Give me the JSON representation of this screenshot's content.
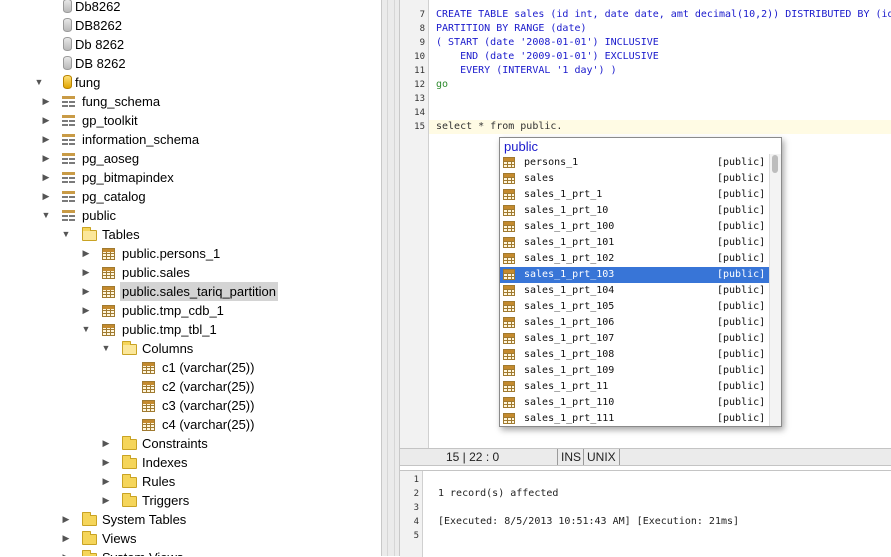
{
  "tree": {
    "items": [
      {
        "label": "Db8262",
        "icon": "database-icon",
        "arrow": "",
        "level": 0
      },
      {
        "label": "DB8262",
        "icon": "database-icon",
        "arrow": "",
        "level": 0
      },
      {
        "label": "Db 8262",
        "icon": "database-icon",
        "arrow": "",
        "level": 0
      },
      {
        "label": "DB 8262",
        "icon": "database-icon",
        "arrow": "",
        "level": 0
      },
      {
        "label": "fung",
        "icon": "database-icon-gold",
        "arrow": "▼",
        "level": 0
      },
      {
        "label": "fung_schema",
        "icon": "schema-icon",
        "arrow": "▶",
        "level": 1
      },
      {
        "label": "gp_toolkit",
        "icon": "schema-icon",
        "arrow": "▶",
        "level": 1
      },
      {
        "label": "information_schema",
        "icon": "schema-icon",
        "arrow": "▶",
        "level": 1
      },
      {
        "label": "pg_aoseg",
        "icon": "schema-icon",
        "arrow": "▶",
        "level": 1
      },
      {
        "label": "pg_bitmapindex",
        "icon": "schema-icon",
        "arrow": "▶",
        "level": 1
      },
      {
        "label": "pg_catalog",
        "icon": "schema-icon",
        "arrow": "▶",
        "level": 1
      },
      {
        "label": "public",
        "icon": "schema-icon",
        "arrow": "▼",
        "level": 1
      },
      {
        "label": "Tables",
        "icon": "folder-open-icon",
        "arrow": "▼",
        "level": 2
      },
      {
        "label": "public.persons_1",
        "icon": "table-icon",
        "arrow": "▶",
        "level": 3
      },
      {
        "label": "public.sales",
        "icon": "table-icon",
        "arrow": "▶",
        "level": 3
      },
      {
        "label": "public.sales_tariq_partition",
        "icon": "table-icon",
        "arrow": "▶",
        "level": 3,
        "selected": true
      },
      {
        "label": "public.tmp_cdb_1",
        "icon": "table-icon",
        "arrow": "▶",
        "level": 3
      },
      {
        "label": "public.tmp_tbl_1",
        "icon": "table-icon",
        "arrow": "▼",
        "level": 3
      },
      {
        "label": "Columns",
        "icon": "folder-open-icon",
        "arrow": "▼",
        "level": 4
      },
      {
        "label": "c1 (varchar(25))",
        "icon": "column-icon",
        "arrow": "",
        "level": 5
      },
      {
        "label": "c2 (varchar(25))",
        "icon": "column-icon",
        "arrow": "",
        "level": 5
      },
      {
        "label": "c3 (varchar(25))",
        "icon": "column-icon",
        "arrow": "",
        "level": 5
      },
      {
        "label": "c4 (varchar(25))",
        "icon": "column-icon",
        "arrow": "",
        "level": 5
      },
      {
        "label": "Constraints",
        "icon": "folder-icon",
        "arrow": "▶",
        "level": 4
      },
      {
        "label": "Indexes",
        "icon": "folder-icon",
        "arrow": "▶",
        "level": 4
      },
      {
        "label": "Rules",
        "icon": "folder-icon",
        "arrow": "▶",
        "level": 4
      },
      {
        "label": "Triggers",
        "icon": "folder-icon",
        "arrow": "▶",
        "level": 4
      },
      {
        "label": "System Tables",
        "icon": "folder-icon",
        "arrow": "▶",
        "level": 2
      },
      {
        "label": "Views",
        "icon": "folder-icon",
        "arrow": "▶",
        "level": 2
      },
      {
        "label": "System Views",
        "icon": "folder-icon",
        "arrow": "▶",
        "level": 2
      }
    ]
  },
  "editor": {
    "line_numbers": [
      "7",
      "8",
      "9",
      "10",
      "11",
      "12",
      "13",
      "14",
      "15"
    ],
    "lines": [
      "CREATE TABLE sales (id int, date date, amt decimal(10,2)) DISTRIBUTED BY (id)",
      "PARTITION BY RANGE (date)",
      "( START (date '2008-01-01') INCLUSIVE",
      "    END (date '2009-01-01') EXCLUSIVE",
      "    EVERY (INTERVAL '1 day') )",
      "go",
      "",
      "",
      "select * from public."
    ]
  },
  "status": {
    "position": "15 | 22 : 0",
    "mode": "INS",
    "line_ending": "UNIX"
  },
  "output": {
    "line_numbers": [
      "1",
      "2",
      "3",
      "4",
      "5"
    ],
    "lines": [
      "",
      "1 record(s) affected",
      "",
      "[Executed: 8/5/2013 10:51:43 AM] [Execution: 21ms]",
      ""
    ]
  },
  "autocomplete": {
    "title": "public",
    "selected_index": 7,
    "items": [
      {
        "name": "persons_1",
        "schema": "[public]"
      },
      {
        "name": "sales",
        "schema": "[public]"
      },
      {
        "name": "sales_1_prt_1",
        "schema": "[public]"
      },
      {
        "name": "sales_1_prt_10",
        "schema": "[public]"
      },
      {
        "name": "sales_1_prt_100",
        "schema": "[public]"
      },
      {
        "name": "sales_1_prt_101",
        "schema": "[public]"
      },
      {
        "name": "sales_1_prt_102",
        "schema": "[public]"
      },
      {
        "name": "sales_1_prt_103",
        "schema": "[public]"
      },
      {
        "name": "sales_1_prt_104",
        "schema": "[public]"
      },
      {
        "name": "sales_1_prt_105",
        "schema": "[public]"
      },
      {
        "name": "sales_1_prt_106",
        "schema": "[public]"
      },
      {
        "name": "sales_1_prt_107",
        "schema": "[public]"
      },
      {
        "name": "sales_1_prt_108",
        "schema": "[public]"
      },
      {
        "name": "sales_1_prt_109",
        "schema": "[public]"
      },
      {
        "name": "sales_1_prt_11",
        "schema": "[public]"
      },
      {
        "name": "sales_1_prt_110",
        "schema": "[public]"
      },
      {
        "name": "sales_1_prt_111",
        "schema": "[public]"
      }
    ]
  },
  "colors": {
    "selection": "#3875d7",
    "keyword": "#1a1acc",
    "string": "#9c2b10",
    "current_line": "#fffbe4"
  }
}
